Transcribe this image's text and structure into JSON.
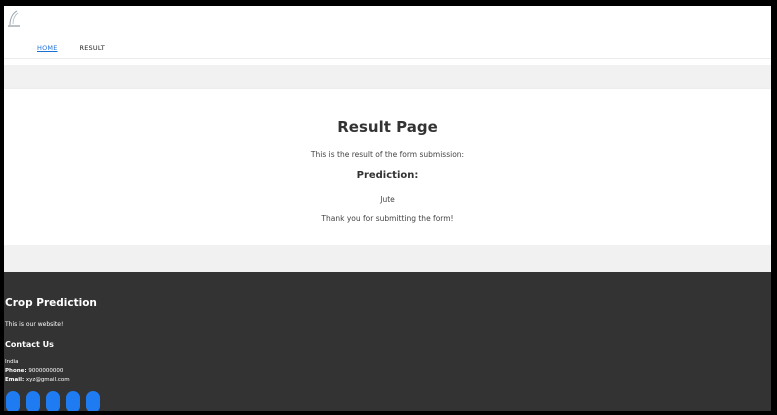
{
  "nav": {
    "home": "HOME",
    "result": "RESULT"
  },
  "main": {
    "title": "Result Page",
    "intro": "This is the result of the form submission:",
    "prediction_heading": "Prediction:",
    "prediction_value": "Jute",
    "thanks": "Thank you for submitting the form!"
  },
  "footer": {
    "brand": "Crop Prediction",
    "tagline": "This is our website!",
    "contact_heading": "Contact Us",
    "country": "India",
    "phone_label": "Phone:",
    "phone_value": "9000000000",
    "email_label": "Email:",
    "email_value": "xyz@gmail.com",
    "social_icons": [
      "social-icon-1",
      "social-icon-2",
      "social-icon-3",
      "social-icon-4",
      "social-icon-5"
    ]
  },
  "colors": {
    "accent": "#1d6fd8",
    "footer_bg": "#333333",
    "social": "#1e7bf2"
  }
}
